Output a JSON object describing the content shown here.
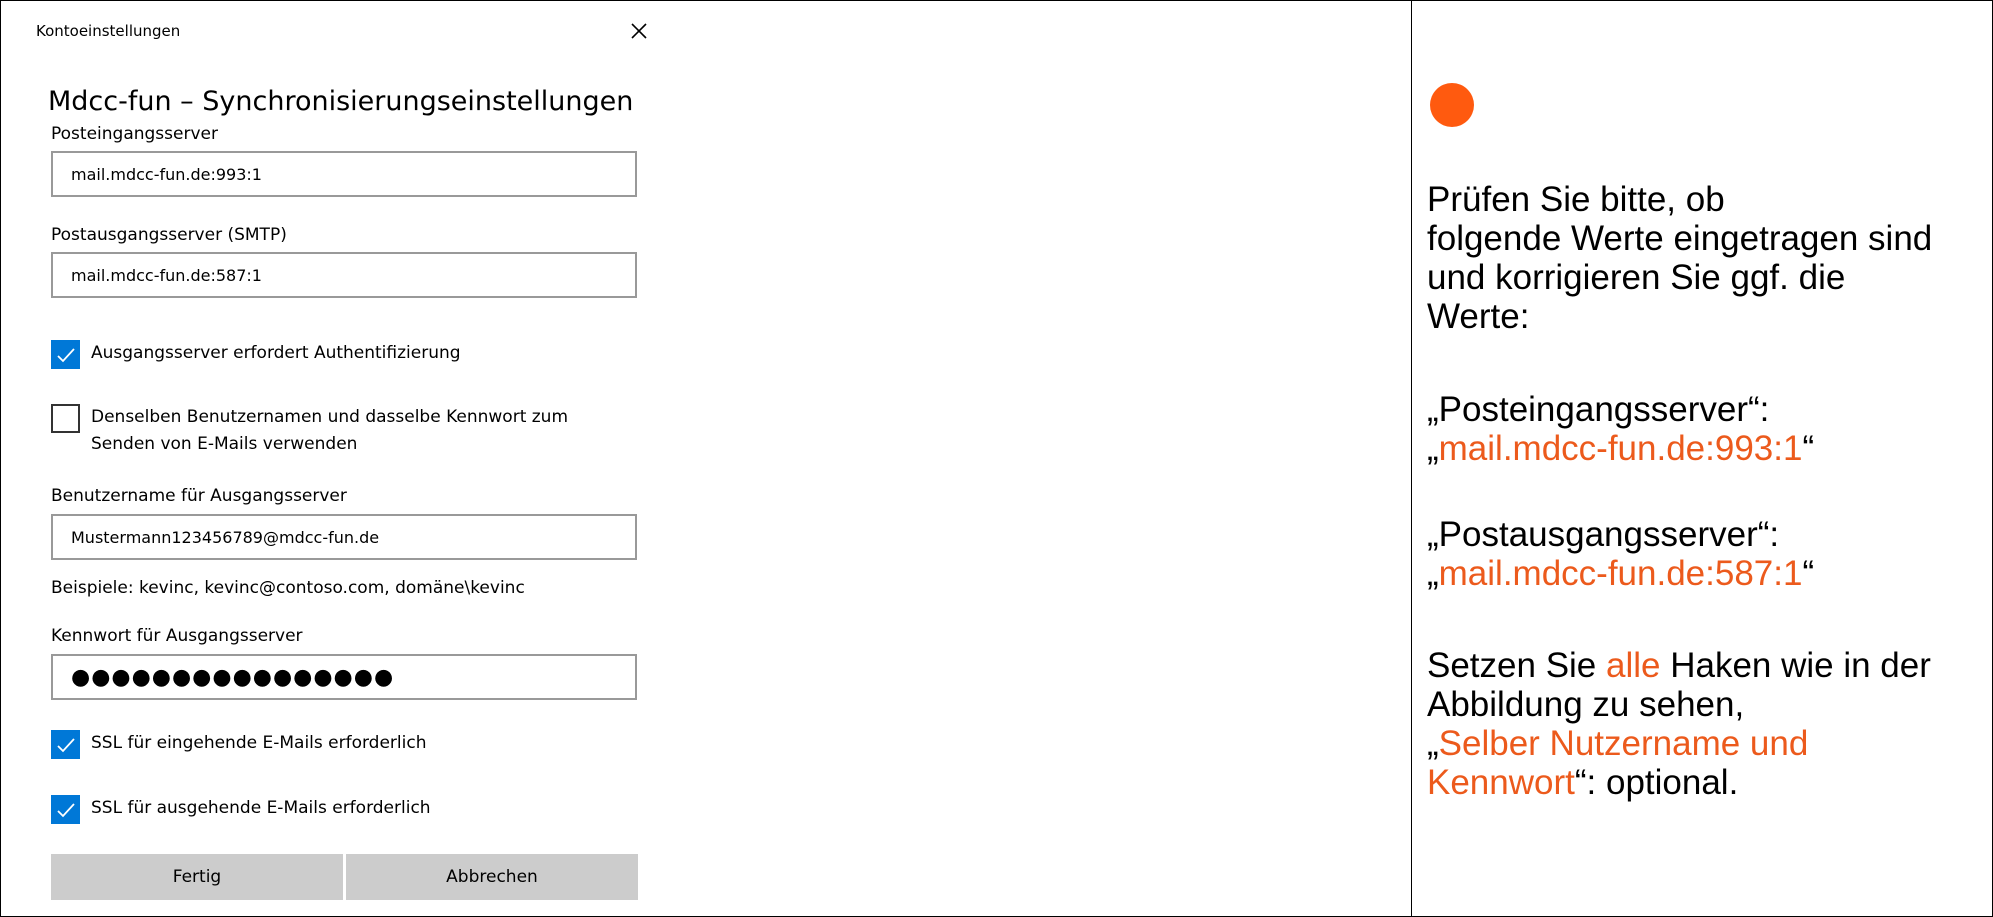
{
  "dialog": {
    "window_title": "Kontoeinstellungen",
    "heading": "Mdcc-fun – Synchronisierungseinstellungen",
    "incoming_label": "Posteingangsserver",
    "incoming_value": "mail.mdcc-fun.de:993:1",
    "outgoing_label": "Postausgangsserver (SMTP)",
    "outgoing_value": "mail.mdcc-fun.de:587:1",
    "auth_required_label": "Ausgangsserver erfordert Authentifizierung",
    "auth_required_checked": true,
    "same_credentials_label_line1": "Denselben Benutzernamen und dasselbe Kennwort zum",
    "same_credentials_label_line2": "Senden von E-Mails verwenden",
    "same_credentials_checked": false,
    "username_label": "Benutzername für Ausgangsserver",
    "username_value": "Mustermann123456789@mdcc-fun.de",
    "username_hint": "Beispiele: kevinc, kevinc@contoso.com, domäne\\kevinc",
    "password_label": "Kennwort für Ausgangsserver",
    "password_value": "●●●●●●●●●●●●●●●●",
    "ssl_incoming_label": "SSL für eingehende E-Mails erforderlich",
    "ssl_incoming_checked": true,
    "ssl_outgoing_label": "SSL für ausgehende E-Mails erforderlich",
    "ssl_outgoing_checked": true,
    "done_label": "Fertig",
    "cancel_label": "Abbrechen",
    "close_icon": "close-icon",
    "checkbox_color": "#0078d7",
    "button_color": "#cccccc"
  },
  "instructions": {
    "dot_color": "#ff5a0f",
    "accent_color": "#ec5a1c",
    "intro_line1": "Prüfen Sie bitte, ob",
    "intro_line2": "folgende Werte eingetragen sind",
    "intro_line3": "und korrigieren Sie ggf. die",
    "intro_line4": "Werte:",
    "incoming_heading": "„Posteingangsserver“:",
    "incoming_open_quote": "„",
    "incoming_value": "mail.mdcc-fun.de:993:1",
    "incoming_close_quote": "“",
    "outgoing_heading": "„Postausgangsserver“:",
    "outgoing_open_quote": "„",
    "outgoing_value": "mail.mdcc-fun.de:587:1",
    "outgoing_close_quote": "“",
    "check_line1_pre": "Setzen Sie ",
    "check_line1_accent": "alle",
    "check_line1_post": " Haken wie in der",
    "check_line2": "Abbildung zu sehen,",
    "optional_open_quote": "„",
    "optional_accent_line1": "Selber Nutzername und",
    "optional_accent_line2": "Kennwort",
    "optional_post": "“: optional."
  }
}
